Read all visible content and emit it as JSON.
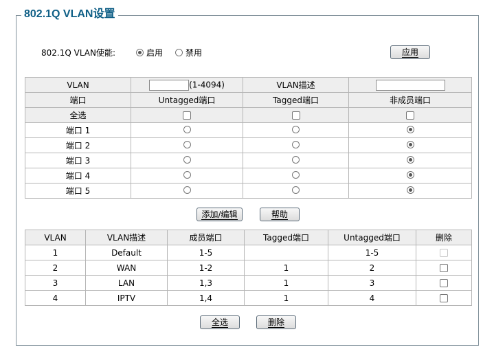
{
  "title": "802.1Q VLAN设置",
  "enable": {
    "label": "802.1Q VLAN使能:",
    "on_label": "启用",
    "off_label": "禁用",
    "selected": "启用",
    "apply_label": "应用"
  },
  "form": {
    "vlan_label": "VLAN",
    "vlan_value": "",
    "vlan_range": "(1-4094)",
    "desc_label": "VLAN描述",
    "desc_value": "",
    "col_port": "端口",
    "col_untagged": "Untagged端口",
    "col_tagged": "Tagged端口",
    "col_nonmember": "非成员端口",
    "select_all_label": "全选",
    "ports": [
      {
        "label": "端口 1",
        "selected": "非成员端口"
      },
      {
        "label": "端口 2",
        "selected": "非成员端口"
      },
      {
        "label": "端口 3",
        "selected": "非成员端口"
      },
      {
        "label": "端口 4",
        "selected": "非成员端口"
      },
      {
        "label": "端口 5",
        "selected": "非成员端口"
      }
    ]
  },
  "form_buttons": {
    "add_edit": "添加/编辑",
    "help": "帮助"
  },
  "vlan_table": {
    "headers": [
      "VLAN",
      "VLAN描述",
      "成员端口",
      "Tagged端口",
      "Untagged端口",
      "删除"
    ],
    "rows": [
      {
        "vlan": "1",
        "desc": "Default",
        "members": "1-5",
        "tagged": "",
        "untagged": "1-5",
        "deletable": false
      },
      {
        "vlan": "2",
        "desc": "WAN",
        "members": "1-2",
        "tagged": "1",
        "untagged": "2",
        "deletable": true
      },
      {
        "vlan": "3",
        "desc": "LAN",
        "members": "1,3",
        "tagged": "1",
        "untagged": "3",
        "deletable": true
      },
      {
        "vlan": "4",
        "desc": "IPTV",
        "members": "1,4",
        "tagged": "1",
        "untagged": "4",
        "deletable": true
      }
    ]
  },
  "bottom_buttons": {
    "select_all": "全选",
    "delete": "删除"
  },
  "colors": {
    "title": "#0f5f86",
    "header_bg": "#eeeeee",
    "border": "#b5b5b5"
  }
}
